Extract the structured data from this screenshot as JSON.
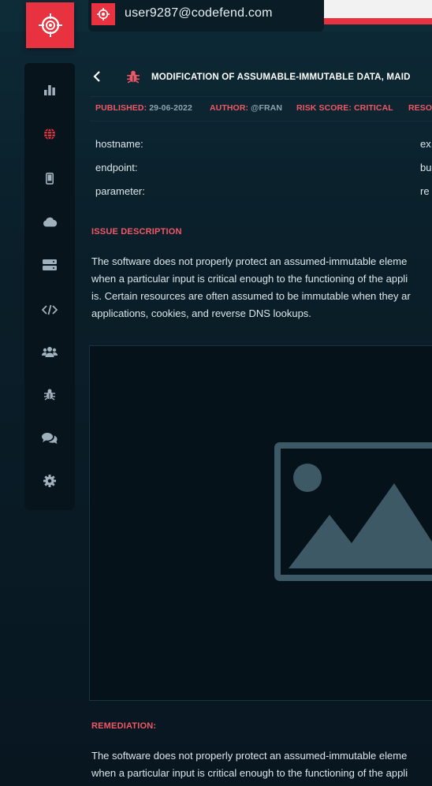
{
  "header": {
    "user_email": "user9287@codefend.com"
  },
  "sidebar": {
    "items": [
      {
        "name": "dashboard",
        "icon": "bar-chart-icon",
        "active": false
      },
      {
        "name": "web",
        "icon": "globe-icon",
        "active": true
      },
      {
        "name": "mobile",
        "icon": "mobile-icon",
        "active": false
      },
      {
        "name": "cloud",
        "icon": "cloud-icon",
        "active": false
      },
      {
        "name": "server",
        "icon": "server-icon",
        "active": false
      },
      {
        "name": "source-code",
        "icon": "code-icon",
        "active": false
      },
      {
        "name": "social",
        "icon": "users-icon",
        "active": false
      },
      {
        "name": "issues",
        "icon": "bug-icon",
        "active": false
      },
      {
        "name": "support",
        "icon": "comments-icon",
        "active": false
      },
      {
        "name": "settings",
        "icon": "gear-icon",
        "active": false
      }
    ]
  },
  "issue": {
    "title": "MODIFICATION OF ASSUMABLE-IMMUTABLE DATA, MAID",
    "published_label": "PUBLISHED:",
    "published_value": "29-06-2022",
    "author_label": "AUTHOR:",
    "author_value": "@FRAN",
    "risk_label": "RISK SCORE:",
    "risk_value": "CRITICAL",
    "resources_label": "RESO",
    "fields": [
      {
        "label": "hostname:",
        "value": "ex."
      },
      {
        "label": "endpoint:",
        "value": "bu"
      },
      {
        "label": "parameter:",
        "value": "re"
      }
    ],
    "description_title": "ISSUE DESCRIPTION",
    "description_lines": [
      "The software does not properly protect an assumed-immutable eleme",
      "when a particular input is critical enough to the functioning of the appli",
      "is. Certain resources are often assumed to be immutable when they ar",
      "applications, cookies, and reverse DNS lookups."
    ],
    "remediation_title": "REMEDIATION:",
    "remediation_lines": [
      "The software does not properly protect an assumed-immutable eleme",
      "when a particular input is critical enough to the functioning of the appli"
    ]
  },
  "colors": {
    "accent": "#e8323f",
    "label_red": "#f05866",
    "sidebar_bg": "#07141b",
    "icon_gray": "#9fb1ba"
  }
}
